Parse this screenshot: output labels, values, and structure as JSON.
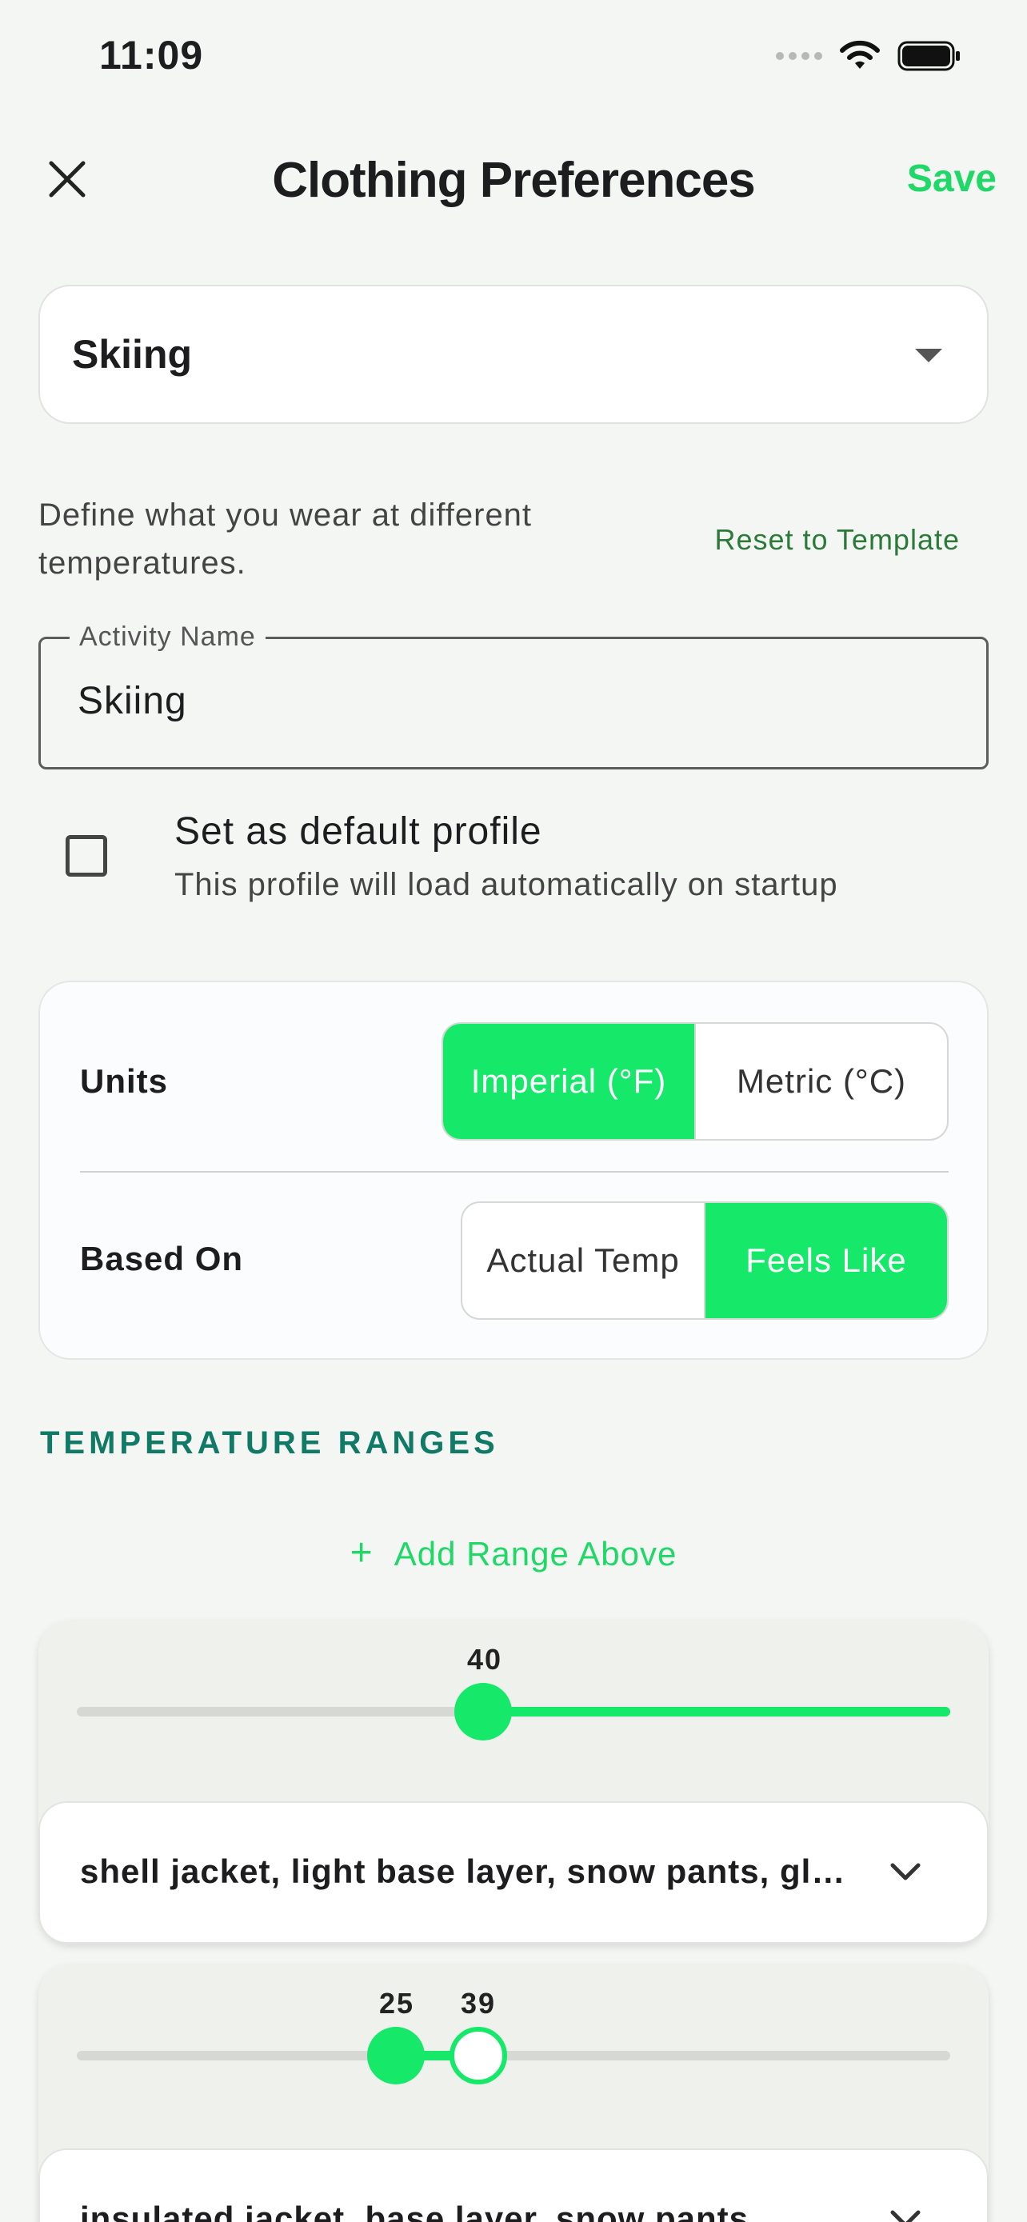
{
  "status_bar": {
    "time": "11:09"
  },
  "header": {
    "title": "Clothing Preferences",
    "save_label": "Save",
    "close_icon": "close-icon"
  },
  "profile_select": {
    "value": "Skiing"
  },
  "description": {
    "text": "Define what you wear at different temperatures.",
    "reset_label": "Reset to Template"
  },
  "activity_field": {
    "label": "Activity Name",
    "value": "Skiing"
  },
  "default_profile": {
    "title": "Set as default profile",
    "subtitle": "This profile will load automatically on startup",
    "checked": false
  },
  "settings": {
    "units": {
      "label": "Units",
      "options": [
        "Imperial (°F)",
        "Metric (°C)"
      ],
      "selected": "Imperial (°F)"
    },
    "based_on": {
      "label": "Based On",
      "options": [
        "Actual Temp",
        "Feels Like"
      ],
      "selected": "Feels Like"
    }
  },
  "temperature_ranges": {
    "section_title": "TEMPERATURE RANGES",
    "add_above_label": "Add Range Above",
    "ranges": [
      {
        "min_label": "40",
        "fill_from": 0.465,
        "fill_to": 1.0,
        "clothing": "shell jacket, light base layer, snow pants, gloves, helmet"
      },
      {
        "min_label": "25",
        "max_label": "39",
        "fill_from": 0.365,
        "fill_to": 0.46,
        "clothing": "insulated jacket, base layer, snow pants"
      }
    ]
  },
  "colors": {
    "accent": "#16e86a",
    "save": "#1fd867",
    "section": "#117a66",
    "reset_link": "#2c7a3a"
  }
}
